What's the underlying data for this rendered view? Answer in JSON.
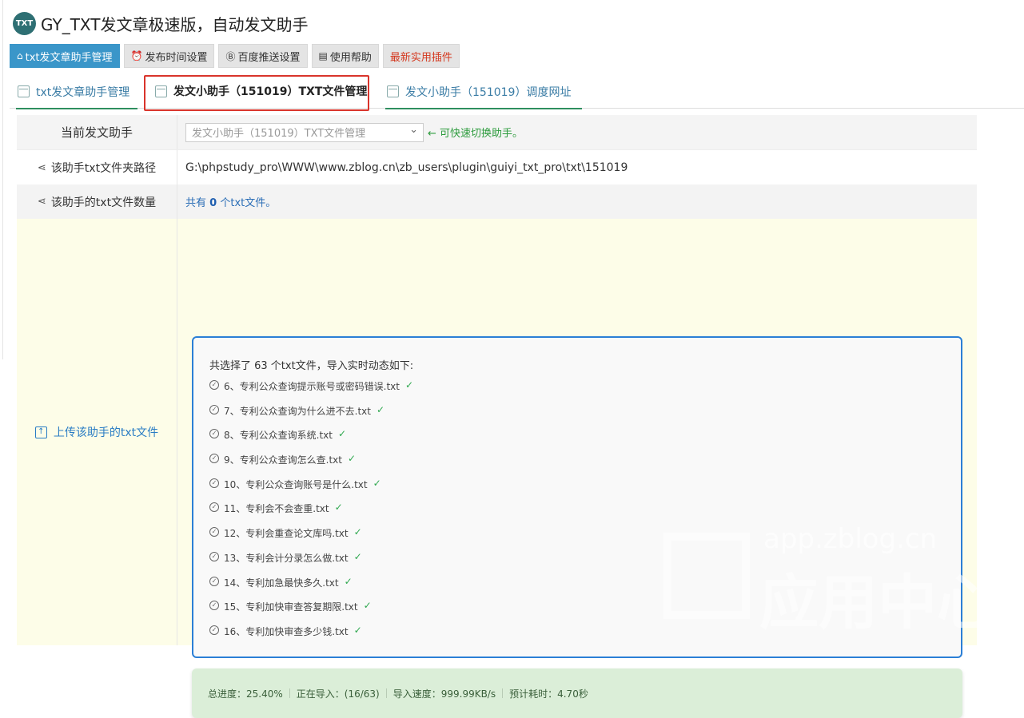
{
  "header": {
    "logo_text": "TXT",
    "title": "GY_TXT发文章极速版，自动发文助手"
  },
  "topnav": [
    {
      "label": "txt发文章助手管理",
      "icon": "home-icon",
      "glyph": "⌂"
    },
    {
      "label": "发布时间设置",
      "icon": "alarm-icon",
      "glyph": "⏰"
    },
    {
      "label": "百度推送设置",
      "icon": "b-icon",
      "glyph": "Ⓑ"
    },
    {
      "label": "使用帮助",
      "icon": "doc-icon",
      "glyph": "▤"
    },
    {
      "label": "最新实用插件"
    }
  ],
  "tabs": [
    {
      "label": "txt发文章助手管理",
      "icon": "calendar-icon"
    },
    {
      "label": "发文小助手（151019）TXT文件管理",
      "icon": "calendar-icon"
    },
    {
      "label": "发文小助手（151019）调度网址",
      "icon": "calendar-icon"
    }
  ],
  "form": {
    "current_label": "当前发文助手",
    "current_select": "发文小助手（151019）TXT文件管理",
    "current_hint": "← 可快速切换助手。",
    "path_label": "该助手txt文件夹路径",
    "path_value": "G:\\phpstudy_pro\\WWW\\www.zblog.cn\\zb_users\\plugin\\guiyi_txt_pro\\txt\\151019",
    "count_label": "该助手的txt文件数量",
    "count_prefix": "共有",
    "count_value": "0",
    "count_suffix": "个txt文件。",
    "upload_label": "上传该助手的txt文件"
  },
  "log": {
    "heading": "共选择了 63 个txt文件，导入实时动态如下:",
    "items": [
      "6、专利公众查询提示账号或密码错误.txt",
      "7、专利公众查询为什么进不去.txt",
      "8、专利公众查询系统.txt",
      "9、专利公众查询怎么查.txt",
      "10、专利公众查询账号是什么.txt",
      "11、专利会不会查重.txt",
      "12、专利会重查论文库吗.txt",
      "13、专利会计分录怎么做.txt",
      "14、专利加急最快多久.txt",
      "15、专利加快审查答复期限.txt",
      "16、专利加快审查多少钱.txt"
    ],
    "ok_mark": "✓"
  },
  "progress": {
    "total": "总进度：25.40%",
    "importing": "正在导入：(16/63)",
    "speed": "导入速度：999.99KB/s",
    "eta": "预计耗时：4.70秒",
    "fraction": 0.254
  },
  "watermark": {
    "url": "app.zblog.cn",
    "text": "应用中心"
  },
  "colors": {
    "primary_button": "#3a96c9",
    "red_text": "#d4381e",
    "hint_green": "#2c9b3c",
    "log_border": "#2b7fd6",
    "progress_bg": "#dbeed8"
  }
}
